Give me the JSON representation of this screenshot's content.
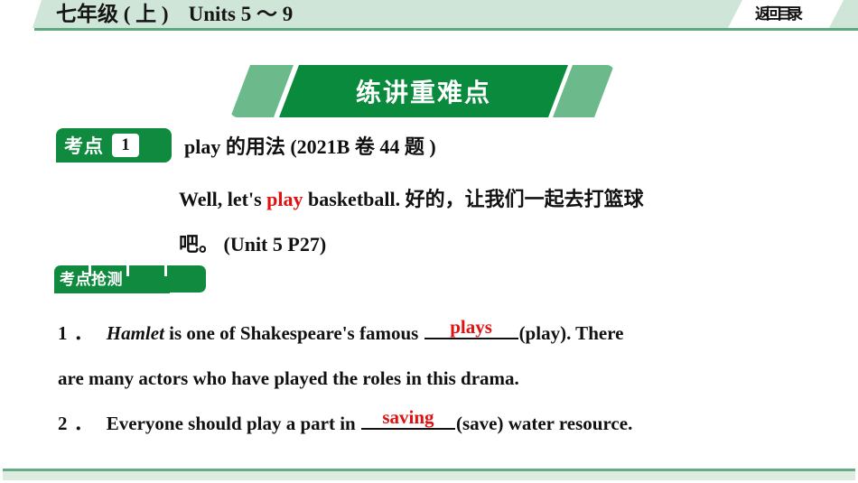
{
  "header": {
    "grade_title": "七年级 ( 上 )",
    "units_title": "Units 5 ～ 9",
    "back_label": "返回目录"
  },
  "banner": {
    "title": "练讲重难点",
    "main_color": "#0a8a3c",
    "accent_color": "#6cba8b"
  },
  "key_point": {
    "badge_label": "考点",
    "badge_number": "1",
    "title": "play 的用法 (2021B 卷 44 题 )",
    "badge_color": "#108a3e"
  },
  "example": {
    "line1_before": "Well, let's ",
    "line1_highlight": "play",
    "line1_after": " basketball. 好的，让我们一起去打篮球",
    "line2": "吧。 (Unit 5 P27)",
    "highlight_color": "#e01111"
  },
  "quiz_tab": {
    "label": "考点抢测"
  },
  "questions": [
    {
      "number": "1 ．",
      "italic_word": "Hamlet",
      "text_before": " is one of Shakespeare's famous ",
      "answer": "plays",
      "text_after": "(play). There",
      "continuation": "are many actors who have played the roles in this drama."
    },
    {
      "number": "2 ．",
      "italic_word": "",
      "text_before": "Everyone should play a part in ",
      "answer": "saving",
      "text_after": "(save) water resource.",
      "continuation": ""
    }
  ],
  "colors": {
    "header_band": "#cfe5d8",
    "header_rule": "#5fa87e",
    "answer_red": "#e01111",
    "footer_fill": "#dcecdf",
    "footer_border": "#6aab87"
  }
}
